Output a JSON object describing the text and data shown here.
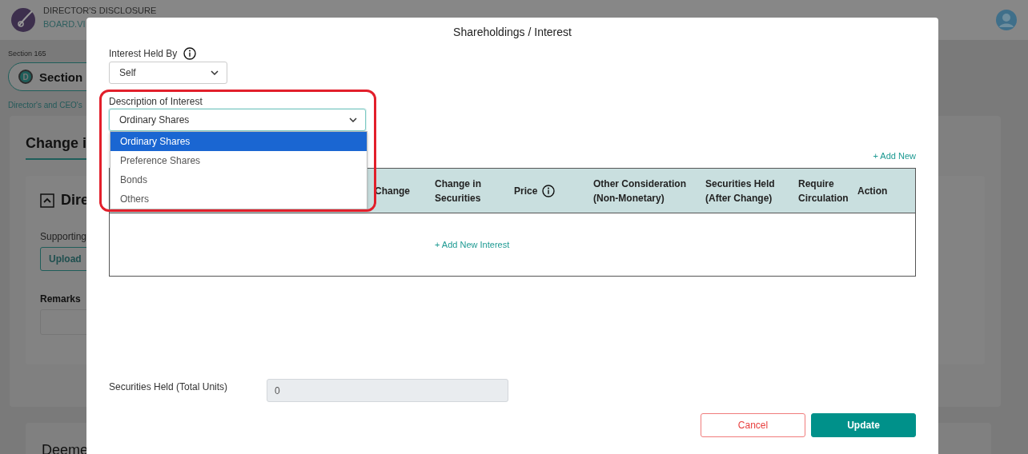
{
  "background": {
    "app_title": "DIRECTOR'S DISCLOSURE",
    "app_subtitle": "BOARD.VI",
    "breadcrumb": "Section 165",
    "section_pill": {
      "badge": "D",
      "label": "Section"
    },
    "section_caption": "Director's and CEO's",
    "card_title": "Change i",
    "panel": {
      "title": "Dire",
      "supporting_label": "Supporting",
      "upload_button": "Upload",
      "remarks_label": "Remarks"
    },
    "card2_title": "Deeme"
  },
  "modal": {
    "title": "Shareholdings / Interest",
    "interest_held_by": {
      "label": "Interest Held By",
      "value": "Self"
    },
    "description": {
      "label": "Description of Interest",
      "value": "Ordinary Shares",
      "options": [
        {
          "label": "Ordinary Shares",
          "selected": true
        },
        {
          "label": "Preference Shares",
          "selected": false
        },
        {
          "label": "Bonds",
          "selected": false
        },
        {
          "label": "Others",
          "selected": false
        }
      ]
    },
    "add_new": "+ Add New",
    "table": {
      "columns": [
        {
          "label": "Change",
          "info": false
        },
        {
          "label": "Change in Securities",
          "info": false
        },
        {
          "label": "Price",
          "info": true
        },
        {
          "label": "Other Consideration (Non-Monetary)",
          "info": false
        },
        {
          "label": "Securities Held (After Change)",
          "info": false
        },
        {
          "label": "Require Circulation",
          "info": false
        },
        {
          "label": "Action",
          "info": false
        }
      ],
      "empty_action": "+ Add New Interest"
    },
    "securities_total": {
      "label": "Securities Held (Total Units)",
      "value": "0"
    },
    "buttons": [
      {
        "label": "Cancel",
        "kind": "secondary"
      },
      {
        "label": "Update",
        "kind": "primary"
      }
    ]
  }
}
